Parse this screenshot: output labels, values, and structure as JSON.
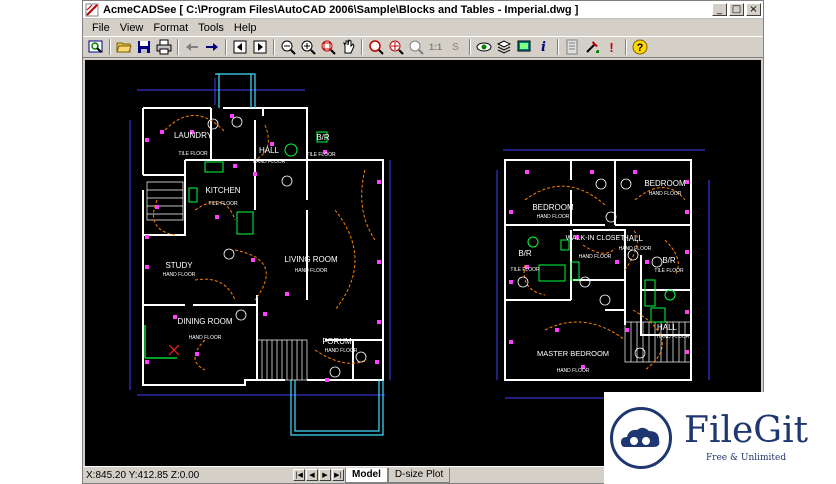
{
  "window": {
    "title": "AcmeCADSee [ C:\\Program Files\\AutoCAD 2006\\Sample\\Blocks and Tables - Imperial.dwg ]",
    "controls": {
      "minimize": "_",
      "maximize": "□",
      "close": "×"
    }
  },
  "menu": [
    "File",
    "View",
    "Format",
    "Tools",
    "Help"
  ],
  "toolbar": {
    "groups": [
      [
        "zoom-window-icon"
      ],
      [
        "open-folder-icon",
        "save-icon",
        "print-icon"
      ],
      [
        "back-arrow-icon",
        "forward-arrow-icon"
      ],
      [
        "prev-page-icon",
        "next-page-icon"
      ],
      [
        "zoom-out-icon",
        "zoom-in-icon",
        "zoom-extents-icon",
        "pan-icon"
      ],
      [
        "zoom-previous-icon",
        "zoom-center-icon",
        "zoom-realtime-icon",
        "one-to-one-icon",
        "layers-s-icon"
      ],
      [
        "eye-icon",
        "layers-icon",
        "display-icon",
        "info-icon"
      ],
      [
        "properties-icon",
        "tools-icon",
        "exclamation-icon"
      ],
      [
        "help-icon"
      ]
    ],
    "one_to_one_label": "1:1",
    "s_label": "S",
    "info_label": "i",
    "excl_label": "!",
    "help_label": "?"
  },
  "drawing": {
    "left_plan": {
      "rooms": [
        {
          "name": "LAUNDRY",
          "floor": "TILE FLOOR"
        },
        {
          "name": "HALL",
          "floor": "HAND FLOOR"
        },
        {
          "name": "B/R",
          "floor": "TILE FLOOR"
        },
        {
          "name": "KITCHEN",
          "floor": "TILE FLOOR"
        },
        {
          "name": "LIVING ROOM",
          "floor": "HAND FLOOR"
        },
        {
          "name": "STUDY",
          "floor": "HAND FLOOR"
        },
        {
          "name": "DINING ROOM",
          "floor": "HAND FLOOR"
        },
        {
          "name": "FORUM",
          "floor": "HAND FLOOR"
        }
      ]
    },
    "right_plan": {
      "rooms": [
        {
          "name": "BEDROOM",
          "floor": "HAND FLOOR"
        },
        {
          "name": "BEDROOM",
          "floor": "HAND FLOOR"
        },
        {
          "name": "B/R",
          "floor": "TILE FLOOR"
        },
        {
          "name": "WALK-IN CLOSET",
          "floor": "HAND FLOOR"
        },
        {
          "name": "HALL",
          "floor": "HAND FLOOR"
        },
        {
          "name": "B/R",
          "floor": "TILE FLOOR"
        },
        {
          "name": "MASTER BEDROOM",
          "floor": "HAND FLOOR"
        },
        {
          "name": "HALL",
          "floor": "HAND FLOOR"
        }
      ]
    }
  },
  "statusbar": {
    "coords": "X:845.20 Y:412.85 Z:0.00",
    "tabs": [
      "Model",
      "D-size Plot"
    ],
    "active_tab": "Model"
  },
  "watermark": {
    "brand": "FileGit",
    "tagline": "Free & Unlimited"
  },
  "colors": {
    "cad_bg": "#000000",
    "wall": "#ffffff",
    "text": "#ffffff",
    "wiring": "#ff8000",
    "marker": "#ff00ff",
    "dimension": "#0000ff",
    "fixture": "#00ff00",
    "stairs": "#00ffff",
    "brand": "#1f3770"
  }
}
